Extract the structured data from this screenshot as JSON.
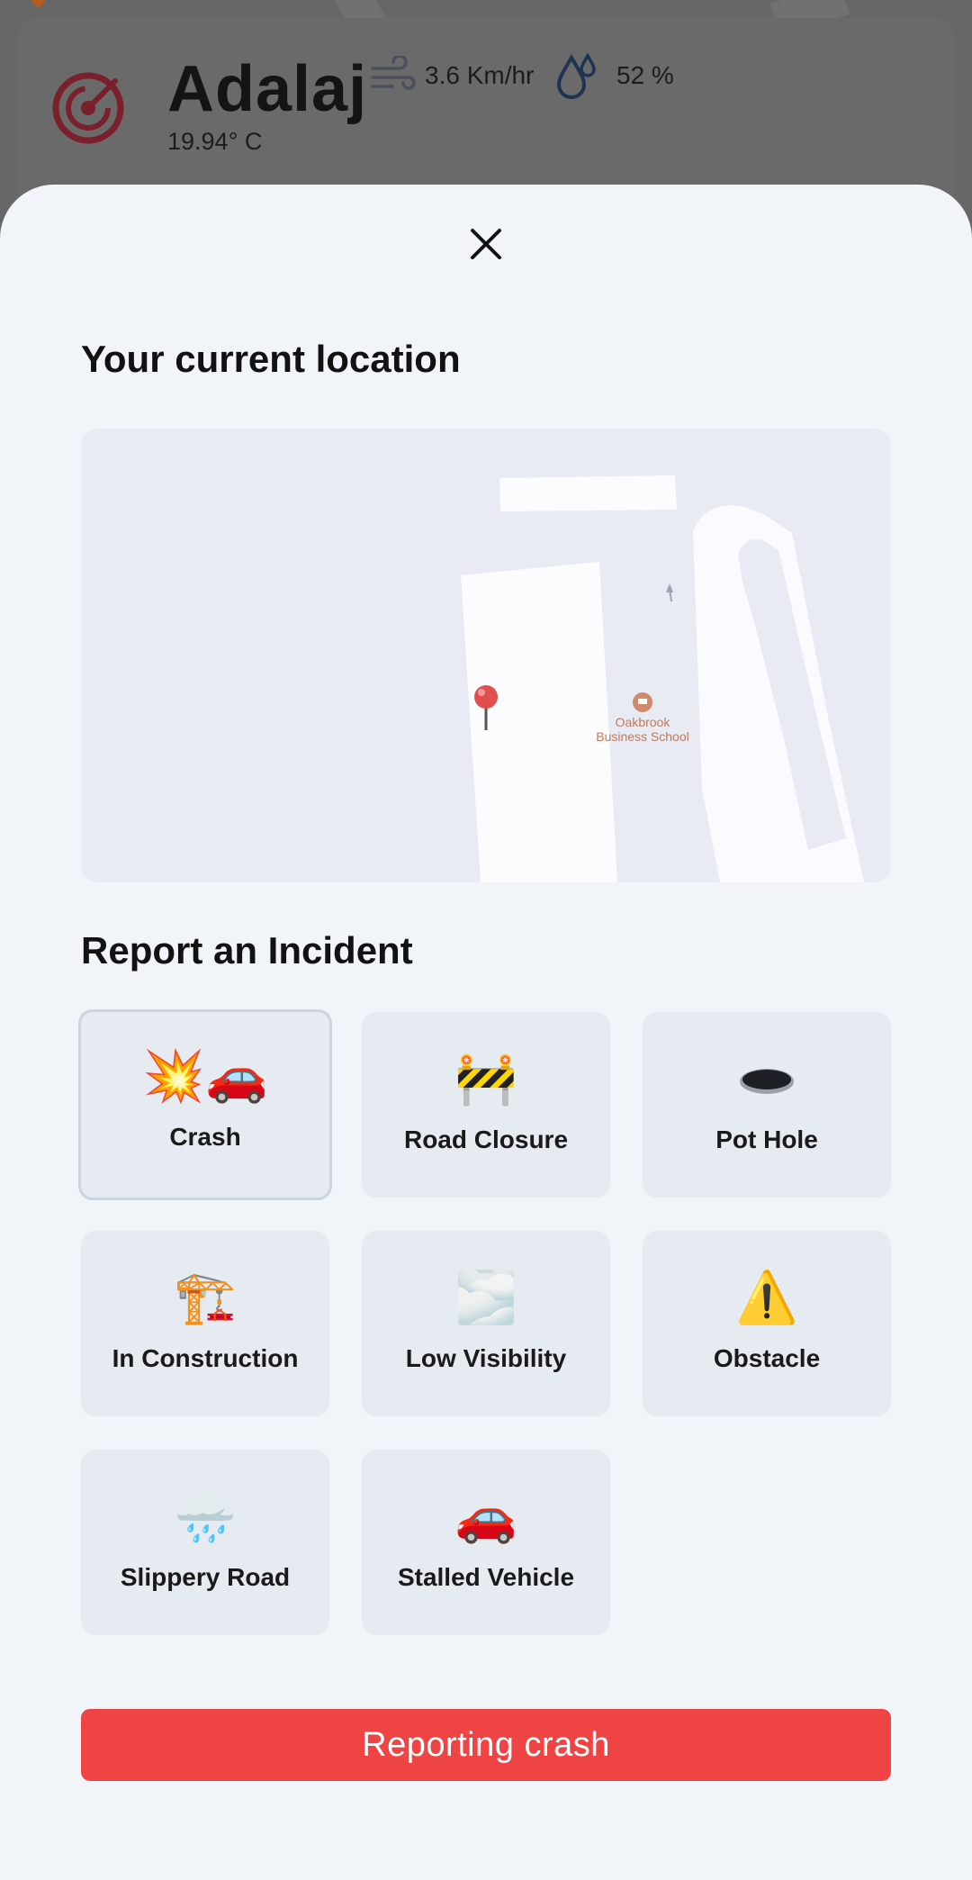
{
  "weather": {
    "city": "Adalaj",
    "temperature": "19.94° C",
    "wind": "3.6 Km/hr",
    "humidity": "52 %"
  },
  "sheet": {
    "close_icon": "close-icon",
    "location_title": "Your current location",
    "map": {
      "poi_line1": "Oakbrook",
      "poi_line2": "Business School"
    },
    "report_title": "Report an Incident",
    "incidents": [
      {
        "label": "Crash",
        "icon": "crash-icon",
        "emoji": "💥🚗",
        "selected": true
      },
      {
        "label": "Road Closure",
        "icon": "road-closure-icon",
        "emoji": "🚧",
        "selected": false
      },
      {
        "label": "Pot Hole",
        "icon": "pothole-icon",
        "emoji": "🕳️",
        "selected": false
      },
      {
        "label": "In Construction",
        "icon": "construction-icon",
        "emoji": "🏗️",
        "selected": false
      },
      {
        "label": "Low Visibility",
        "icon": "fog-icon",
        "emoji": "🌫️",
        "selected": false
      },
      {
        "label": "Obstacle",
        "icon": "warning-icon",
        "emoji": "⚠️",
        "selected": false
      },
      {
        "label": "Slippery Road",
        "icon": "rain-cloud-icon",
        "emoji": "🌧️",
        "selected": false
      },
      {
        "label": "Stalled Vehicle",
        "icon": "car-icon",
        "emoji": "🚗",
        "selected": false
      }
    ],
    "submit_label": "Reporting crash"
  },
  "colors": {
    "accent": "#ef4444",
    "sheet_bg": "#f1f4f8",
    "tile_bg": "#e6eaf1"
  }
}
